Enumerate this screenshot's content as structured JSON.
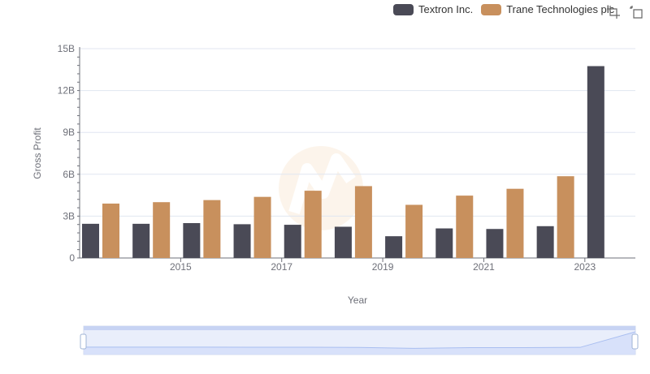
{
  "toolbox": {
    "icons": [
      "zoom-select-icon",
      "zoom-reset-icon"
    ]
  },
  "chart_data": {
    "type": "bar",
    "x": [
      2014,
      2015,
      2016,
      2017,
      2018,
      2019,
      2020,
      2021,
      2022,
      2023,
      2024
    ],
    "x_tick_labels": [
      "2015",
      "2017",
      "2019",
      "2021",
      "2023"
    ],
    "y_tick_labels": [
      "0",
      "3B",
      "6B",
      "9B",
      "12B",
      "15B"
    ],
    "ylim": [
      0,
      15000000000
    ],
    "xlabel": "Year",
    "ylabel": "Gross Profit",
    "legend_position": "top-right",
    "grid": true,
    "series": [
      {
        "name": "Textron Inc.",
        "color": "#4a4a56",
        "values": [
          2450000000,
          2450000000,
          2500000000,
          2420000000,
          2380000000,
          2240000000,
          1560000000,
          2120000000,
          2080000000,
          2280000000,
          13750000000
        ]
      },
      {
        "name": "Trane Technologies plc",
        "color": "#c8905d",
        "values": [
          3900000000,
          4000000000,
          4150000000,
          4380000000,
          4820000000,
          5150000000,
          3810000000,
          4470000000,
          4960000000,
          5860000000,
          null
        ]
      }
    ]
  }
}
